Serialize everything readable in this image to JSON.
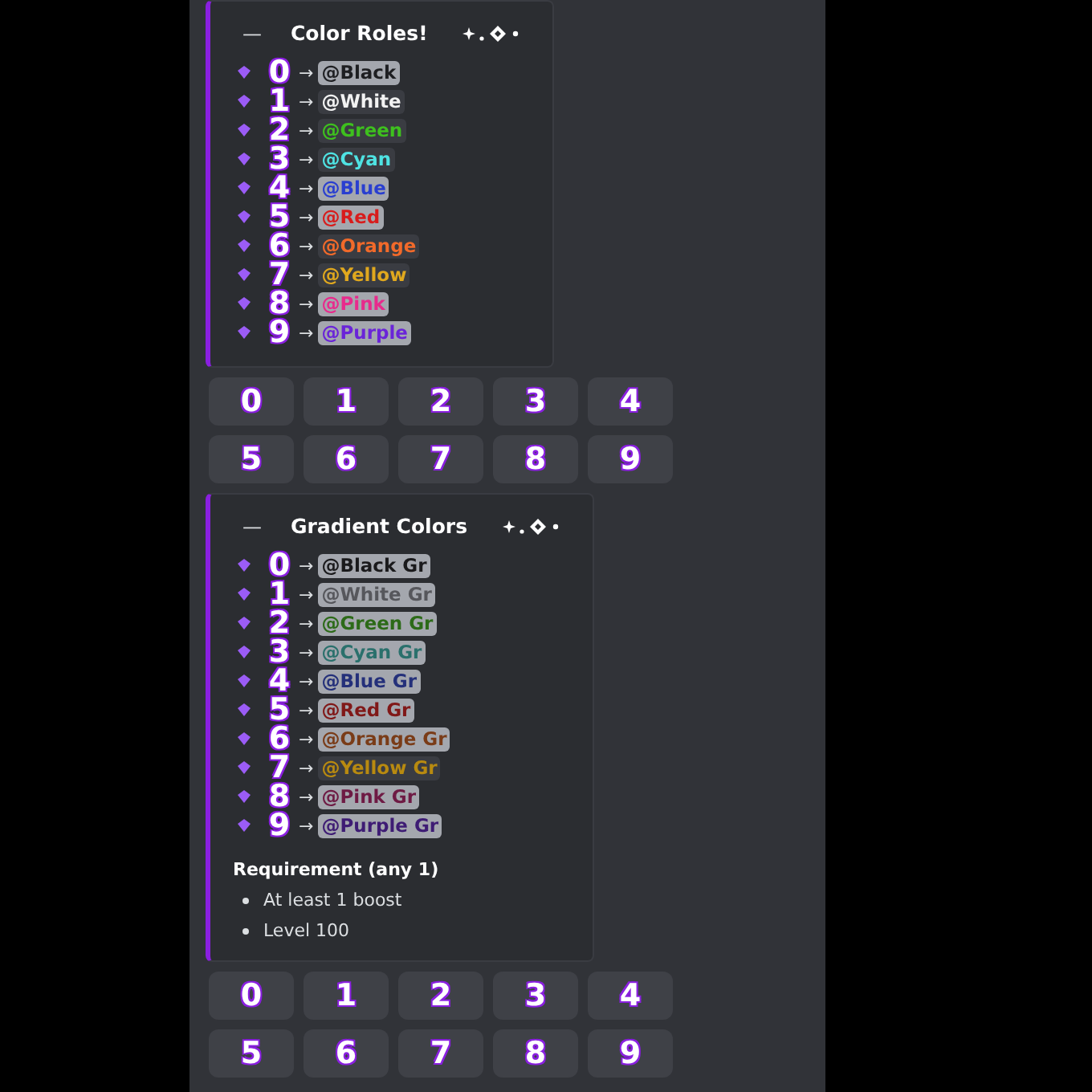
{
  "embeds": [
    {
      "dash": "—",
      "title": "Color Roles!",
      "rows": [
        {
          "digit": "0",
          "arrow": "→",
          "role": "@Black",
          "color": "#1e1f22"
        },
        {
          "digit": "1",
          "arrow": "→",
          "role": "@White",
          "color": "#f2f2f2"
        },
        {
          "digit": "2",
          "arrow": "→",
          "role": "@Green",
          "color": "#3ec01e"
        },
        {
          "digit": "3",
          "arrow": "→",
          "role": "@Cyan",
          "color": "#4fe3e3"
        },
        {
          "digit": "4",
          "arrow": "→",
          "role": "@Blue",
          "color": "#2a3fd0"
        },
        {
          "digit": "5",
          "arrow": "→",
          "role": "@Red",
          "color": "#d81c1c"
        },
        {
          "digit": "6",
          "arrow": "→",
          "role": "@Orange",
          "color": "#f26a2a"
        },
        {
          "digit": "7",
          "arrow": "→",
          "role": "@Yellow",
          "color": "#e0a81e"
        },
        {
          "digit": "8",
          "arrow": "→",
          "role": "@Pink",
          "color": "#e82a8c"
        },
        {
          "digit": "9",
          "arrow": "→",
          "role": "@Purple",
          "color": "#6a24d8"
        }
      ],
      "buttons": [
        [
          "0",
          "1",
          "2",
          "3",
          "4"
        ],
        [
          "5",
          "6",
          "7",
          "8",
          "9"
        ]
      ]
    },
    {
      "dash": "—",
      "title": "Gradient Colors",
      "rows": [
        {
          "digit": "0",
          "arrow": "→",
          "role": "@Black Gr",
          "color": "#1a1a1c"
        },
        {
          "digit": "1",
          "arrow": "→",
          "role": "@White Gr",
          "color": "#56575c"
        },
        {
          "digit": "2",
          "arrow": "→",
          "role": "@Green Gr",
          "color": "#2c6a18"
        },
        {
          "digit": "3",
          "arrow": "→",
          "role": "@Cyan Gr",
          "color": "#2a706c"
        },
        {
          "digit": "4",
          "arrow": "→",
          "role": "@Blue Gr",
          "color": "#24307a"
        },
        {
          "digit": "5",
          "arrow": "→",
          "role": "@Red Gr",
          "color": "#801818"
        },
        {
          "digit": "6",
          "arrow": "→",
          "role": "@Orange Gr",
          "color": "#7a3c18"
        },
        {
          "digit": "7",
          "arrow": "→",
          "role": "@Yellow Gr",
          "color": "#b88a10"
        },
        {
          "digit": "8",
          "arrow": "→",
          "role": "@Pink Gr",
          "color": "#6e1a44"
        },
        {
          "digit": "9",
          "arrow": "→",
          "role": "@Purple Gr",
          "color": "#3e1c74"
        }
      ],
      "requirement": {
        "title": "Requirement (any 1)",
        "items": [
          "At least 1 boost",
          "Level 100"
        ]
      },
      "buttons": [
        [
          "0",
          "1",
          "2",
          "3",
          "4"
        ],
        [
          "5",
          "6",
          "7",
          "8",
          "9"
        ]
      ]
    }
  ]
}
